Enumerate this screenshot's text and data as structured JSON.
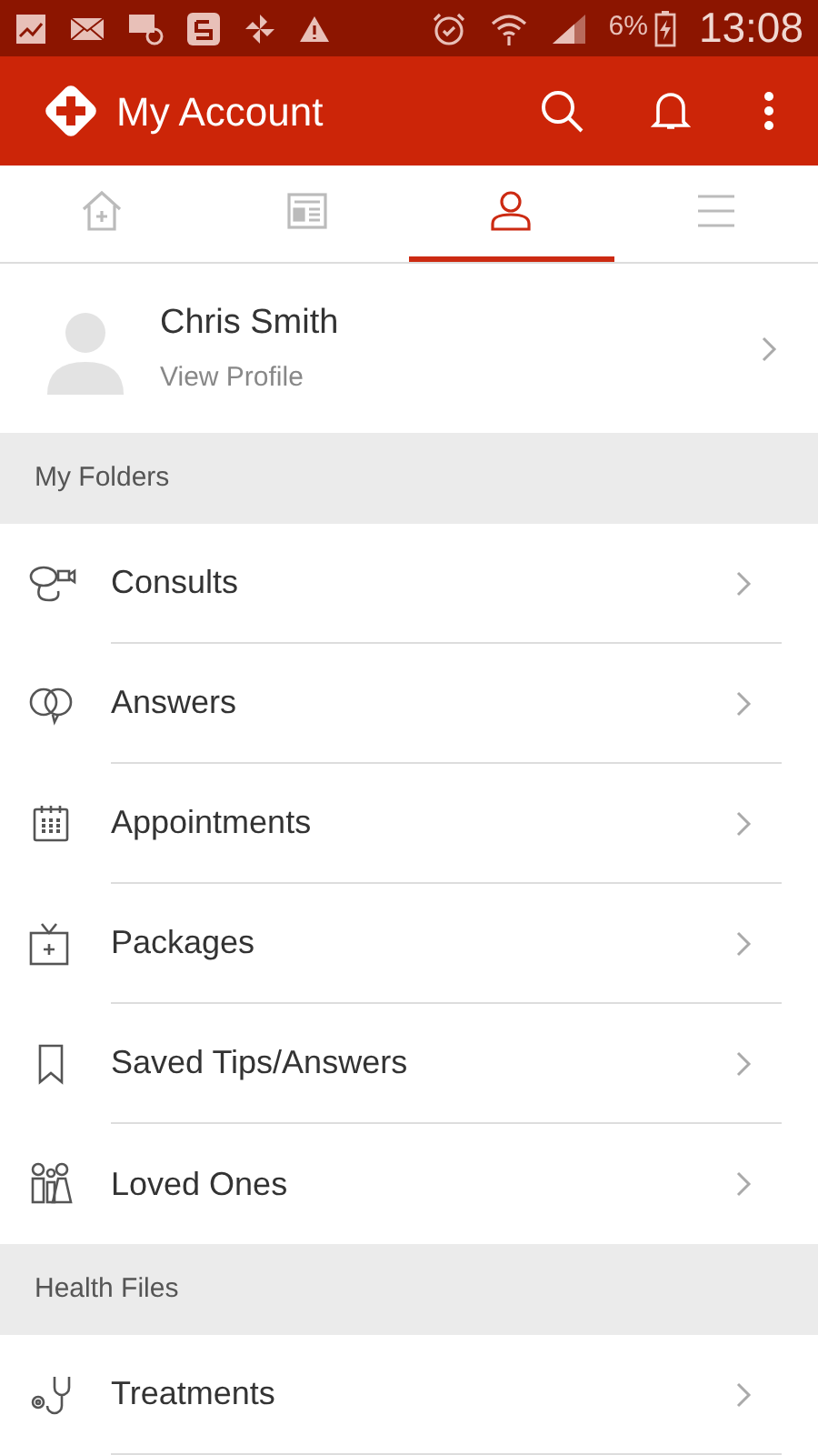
{
  "status_bar": {
    "battery": "6%",
    "time": "13:08"
  },
  "app_bar": {
    "title": "My Account"
  },
  "tabs": [
    {
      "kind": "home",
      "selected": false
    },
    {
      "kind": "news",
      "selected": false
    },
    {
      "kind": "profile",
      "selected": true
    },
    {
      "kind": "menu",
      "selected": false
    }
  ],
  "profile": {
    "name": "Chris Smith",
    "link": "View Profile"
  },
  "sections": [
    {
      "title": "My Folders",
      "items": [
        {
          "label": "Consults",
          "kind": "consult"
        },
        {
          "label": "Answers",
          "kind": "answers"
        },
        {
          "label": "Appointments",
          "kind": "calendar"
        },
        {
          "label": "Packages",
          "kind": "package"
        },
        {
          "label": "Saved Tips/Answers",
          "kind": "bookmark"
        },
        {
          "label": "Loved Ones",
          "kind": "family"
        }
      ]
    },
    {
      "title": "Health Files",
      "items": [
        {
          "label": "Treatments",
          "kind": "stethoscope"
        }
      ]
    }
  ]
}
